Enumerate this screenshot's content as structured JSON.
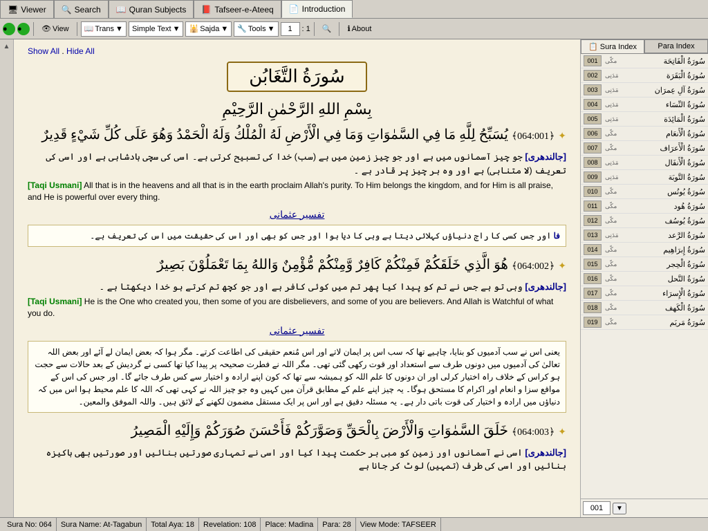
{
  "tabs": [
    {
      "id": "viewer",
      "label": "Viewer",
      "icon": "🖥",
      "active": false
    },
    {
      "id": "search",
      "label": "Search",
      "icon": "🔍",
      "active": false
    },
    {
      "id": "quran-subjects",
      "label": "Quran Subjects",
      "icon": "📖",
      "active": false
    },
    {
      "id": "tafseer-e-ateeq",
      "label": "Tafseer-e-Ateeq",
      "icon": "📕",
      "active": false
    },
    {
      "id": "introduction",
      "label": "Introduction",
      "icon": "📄",
      "active": true
    }
  ],
  "toolbar": {
    "back_label": "◀",
    "forward_label": "▶",
    "view_label": "View",
    "trans_label": "Trans",
    "simple_text_label": "Simple Text",
    "sajda_label": "Sajda",
    "tools_label": "Tools",
    "page_num": "1",
    "page_sep": ": 1",
    "search_icon": "🔍",
    "about_label": "About"
  },
  "content": {
    "show_all_label": "Show All",
    "dot_label": " . ",
    "hide_all_label": "Hide All",
    "sura_title": "سُورَةُ التَّغَابُن",
    "bismillah": "بِسْمِ اللهِ الرَّحْمٰنِ الرَّحِيْمِ",
    "ayah1": {
      "star": "✦",
      "ref": "﴿064:001﴾",
      "text": "يُسَبِّحُ لِلَّهِ مَا فِي السَّمٰوَاتِ وَمَا فِي الْأَرْضِ لَهُ الْمُلْكُ وَلَهُ الْحَمْدُ وَهُوَ عَلَى كُلِّ شَيْءٍ قَدِيرٌ",
      "trans_jaldendri_label": "[جالندهری]",
      "trans_jaldendri": "جو چیز آسمانوں میں ہے اور جو چیز زمین میں ہے (سب) خدا کی تسبیح کرتی ہے۔ اسی کی سچی بادشاہی ہے اور اسی کی تعریف (لا متناہی) ہے اور وہ ہر چیز پر قادر ہے ۔",
      "trans_taqi_label": "[Taqi Usmani]",
      "trans_taqi": "All that is in the heavens and all that is in the earth proclaim Allah's purity. To Him belongs the kingdom, and for Him is all praise, and He is powerful over every thing.",
      "tafseer_link": "تفسیر عثمانی",
      "tafseer_fa_label": "فا",
      "tafseer_text": "اور جس کسی کا راج دنیاؤں کہلائی دیتا ہے وہی کا دیا ہوا اور جس کو بھی اور اس کی حقیقت میں اس کی تعریف ہے۔"
    },
    "ayah2": {
      "star": "✦",
      "ref": "﴿064:002﴾",
      "text": "هُوَ الَّذِي خَلَقَكُمْ فَمِنْكُمْ كَافِرٌ وَّمِنْكُمْ مُّؤْمِنٌ وَاللهُ بِمَا تَعْمَلُوْنَ بَصِيرٌ",
      "trans_jaldendri_label": "[جالندهری]",
      "trans_jaldendri": "وہی تو ہے جس نے تم کو پیدا کیا پھر تم میں کوئی کافر ہے اور جو کچھ تم کرتے ہو خدا دیکھتا ہے ۔",
      "trans_taqi_label": "[Taqi Usmani]",
      "trans_taqi": "He is the One who created you, then some of you are disbelievers, and some of you are believers. And Allah is Watchful of what you do.",
      "tafseer_link": "تفسیر عثمانی",
      "tafseer_text": "یعنی اس نے سب آدمیوں کو بنایا، چاہیے تھا کہ سب اس پر ایمان لاتے اور اس مُنعم حقیقی کی اطاعت کرتے۔ مگر ہوا کہ بعض ایمان لے آئے اور بعض اللہ تعالیٰ کی آدمیوں میں دونوں طرف سے استعداد اور قوت رکھی گئی تھی۔ مگر اللہ نے فطرت صحیحہ پر پیدا کیا تھا کسی نے گردیش کے بعد حالات سے حجت ہو کراس کے خلاف راہ اختیار کرلی اور ان دونوں کا علم اللہ کو ہمیشہ سے تھا کہ کون اپنے ارادہ و اختیار سے کس طرف جائے گا۔ اور جس کی اس کے مواقع سزا و انعام اور اکرام کا مستحق ہوگا۔ یہ چیز اپنے علم کے مطابق قرآن میں کہیں وہ جو چیز اللہ نے کہی تھی کہ اللہ کا علم محیط ہوا اس میں کہ دنیاؤں میں ارادہ و اختیار کی قوت باتی دار ہے۔ یہ مسئلہ دقیق ہے اور اس پر ایک مستقل مضمون لکھنے کے لائق ہیں۔ واللہ الموفق والمعین۔"
    },
    "ayah3": {
      "star": "✦",
      "ref": "﴿064:003﴾",
      "text": "خَلَقَ السَّمٰوَاتِ وَالْأَرْضَ بِالْحَقِّ وَصَوَّرَكُمْ فَأَحْسَنَ صُوَرَكُمْ وَإِلَيْهِ الْمَصِيرُ",
      "trans_jaldendri_label": "[جالندهری]",
      "trans_jaldendri": "اسی نے آسمانوں اور زمین کو مبی بر حکمت پیدا کیا اور اسی نے تمہاری صورتیں بنائیں اور صورتیں بھی باکیزہ بنائیں اور اسی کی طرف (تمہیں) لوٹ کر جانا ہے"
    }
  },
  "sidebar": {
    "sura_tab": "Sura Index",
    "para_tab": "Para Index",
    "items": [
      {
        "num": "001",
        "label": "سُورَةُ الْفَاتِحَة",
        "type": "مکّی"
      },
      {
        "num": "002",
        "label": "سُورَةُ الْبَقَرَة",
        "type": "مَدَنِی"
      },
      {
        "num": "003",
        "label": "سُورَةُ آلِ عِمرَان",
        "type": "مَدَنِی"
      },
      {
        "num": "004",
        "label": "سُورَةُ النِّسَاء",
        "type": "مَدَنِی"
      },
      {
        "num": "005",
        "label": "سُورَةُ الْمَائِدَة",
        "type": "مَدَنِی"
      },
      {
        "num": "006",
        "label": "سُورَةُ الْأَنعَام",
        "type": "مکّی"
      },
      {
        "num": "007",
        "label": "سُورَةُ الْأَعرَاف",
        "type": "مکّی"
      },
      {
        "num": "008",
        "label": "سُورَةُ الْأَنفَال",
        "type": "مَدَنِی"
      },
      {
        "num": "009",
        "label": "سُورَةُ التَّوبَة",
        "type": "مَدَنِی"
      },
      {
        "num": "010",
        "label": "سُورَةُ يُونُس",
        "type": "مکّی"
      },
      {
        "num": "011",
        "label": "سُورَةُ هُود",
        "type": "مکّی"
      },
      {
        "num": "012",
        "label": "سُورَةُ يُوسُف",
        "type": "مکّی"
      },
      {
        "num": "013",
        "label": "سُورَةُ الرَّعد",
        "type": "مَدَنِی"
      },
      {
        "num": "014",
        "label": "سُورَةُ إِبرَاهِيم",
        "type": "مکّی"
      },
      {
        "num": "015",
        "label": "سُورَةُ الْحِجر",
        "type": "مکّی"
      },
      {
        "num": "016",
        "label": "سُورَةُ النَّحل",
        "type": "مکّی"
      },
      {
        "num": "017",
        "label": "سُورَةُ الْإِسرَاء",
        "type": "مکّی"
      },
      {
        "num": "018",
        "label": "سُورَةُ الْكَهف",
        "type": "مکّی"
      },
      {
        "num": "019",
        "label": "سُورَةُ مَريَم",
        "type": "مکّی"
      }
    ],
    "para_input_value": "001"
  },
  "statusbar": {
    "sura_no": "Sura No: 064",
    "sura_name": "Sura Name: At-Tagabun",
    "total_aya": "Total Aya: 18",
    "revelation": "Revelation: 108",
    "place": "Place: Madina",
    "para": "Para: 28",
    "view_mode": "View Mode: TAFSEER"
  }
}
